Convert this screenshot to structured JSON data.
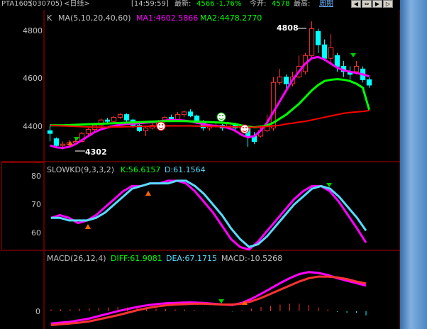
{
  "topbar": {
    "symbol": "PTA1605",
    "code": "(030705)",
    "period": "<日线>",
    "time": "[14:59:59]",
    "latest_label": "最新:",
    "latest_value": "4566",
    "change_pct": "-1.76%",
    "open_label": "今开:",
    "open_value": "4578",
    "high_label": "最高:",
    "cycle_label": "周期"
  },
  "kpanel": {
    "title": "K",
    "ma_label": "MA(5,10,20,40,60)",
    "ma1": "MA1:4602.5866",
    "ma2": "MA2:4478.2770",
    "ticks": [
      "4800",
      "4600",
      "4400"
    ],
    "high_mark": "4808",
    "low_mark": "4302"
  },
  "kdpanel": {
    "title": "SLOWKD(9,3,3,2)",
    "k": "K:56.6157",
    "d": "D:61.1564",
    "ticks": [
      "80",
      "70",
      "60"
    ]
  },
  "macdpanel": {
    "title": "MACD(26,12,4)",
    "diff": "DIFF:61.9081",
    "dea": "DEA:67.1715",
    "macd": "MACD:-10.5268",
    "ticks": [
      "0"
    ]
  },
  "colors": {
    "up": "#ff3232",
    "down": "#00ffff",
    "ma1": "#ff00ff",
    "ma2": "#00ff00",
    "ma3": "#ff0000",
    "kline": "#ff00ff",
    "dline": "#55ddff",
    "axis": "#c0c0c0",
    "panelborder": "#b00000"
  },
  "chart_data": [
    {
      "type": "candlestick",
      "title": "K",
      "ylim": [
        4290,
        4850
      ],
      "candles": [
        [
          4400,
          4390,
          4425,
          4360
        ],
        [
          4370,
          4345,
          4375,
          4335
        ],
        [
          4345,
          4350,
          4360,
          4330
        ],
        [
          4350,
          4355,
          4365,
          4340
        ],
        [
          4355,
          4360,
          4370,
          4345
        ],
        [
          4360,
          4390,
          4395,
          4355
        ],
        [
          4390,
          4405,
          4410,
          4385
        ],
        [
          4405,
          4420,
          4425,
          4395
        ],
        [
          4420,
          4440,
          4445,
          4410
        ],
        [
          4440,
          4435,
          4448,
          4430
        ],
        [
          4435,
          4450,
          4455,
          4428
        ],
        [
          4450,
          4460,
          4465,
          4445
        ],
        [
          4460,
          4440,
          4465,
          4430
        ],
        [
          4440,
          4420,
          4445,
          4410
        ],
        [
          4420,
          4400,
          4425,
          4395
        ],
        [
          4400,
          4410,
          4415,
          4380
        ],
        [
          4410,
          4420,
          4430,
          4405
        ],
        [
          4420,
          4435,
          4440,
          4415
        ],
        [
          4435,
          4450,
          4455,
          4430
        ],
        [
          4450,
          4440,
          4460,
          4435
        ],
        [
          4440,
          4460,
          4470,
          4435
        ],
        [
          4460,
          4470,
          4475,
          4450
        ],
        [
          4470,
          4455,
          4480,
          4450
        ],
        [
          4455,
          4430,
          4460,
          4425
        ],
        [
          4430,
          4410,
          4440,
          4400
        ],
        [
          4410,
          4420,
          4425,
          4400
        ],
        [
          4420,
          4420,
          4430,
          4410
        ],
        [
          4420,
          4410,
          4425,
          4400
        ],
        [
          4410,
          4425,
          4430,
          4405
        ],
        [
          4425,
          4410,
          4430,
          4400
        ],
        [
          4410,
          4415,
          4420,
          4405
        ],
        [
          4415,
          4380,
          4420,
          4340
        ],
        [
          4380,
          4360,
          4395,
          4350
        ],
        [
          4380,
          4400,
          4420,
          4375
        ],
        [
          4400,
          4420,
          4460,
          4395
        ],
        [
          4410,
          4580,
          4600,
          4400
        ],
        [
          4580,
          4600,
          4630,
          4570
        ],
        [
          4600,
          4575,
          4610,
          4560
        ],
        [
          4575,
          4600,
          4620,
          4565
        ],
        [
          4600,
          4640,
          4680,
          4595
        ],
        [
          4620,
          4680,
          4690,
          4610
        ],
        [
          4680,
          4780,
          4808,
          4670
        ],
        [
          4770,
          4720,
          4780,
          4690
        ],
        [
          4720,
          4670,
          4740,
          4660
        ],
        [
          4670,
          4710,
          4760,
          4650
        ],
        [
          4680,
          4640,
          4690,
          4620
        ],
        [
          4640,
          4620,
          4660,
          4600
        ],
        [
          4620,
          4610,
          4640,
          4590
        ],
        [
          4620,
          4640,
          4660,
          4610
        ],
        [
          4630,
          4590,
          4640,
          4580
        ],
        [
          4590,
          4570,
          4600,
          4560
        ]
      ],
      "series": [
        {
          "name": "MA1",
          "values": [
            4345,
            4338,
            4336,
            4340,
            4350,
            4365,
            4380,
            4395,
            4405,
            4412,
            4418,
            4422,
            4425,
            4426,
            4428,
            4430,
            4432,
            4435,
            4438,
            4440,
            4440,
            4438,
            4435,
            4430,
            4425,
            4420,
            4418,
            4415,
            4410,
            4400,
            4385,
            4375,
            4380,
            4400,
            4430,
            4470,
            4510,
            4550,
            4590,
            4620,
            4650,
            4670,
            4675,
            4665,
            4650,
            4635,
            4625,
            4620,
            4615,
            4610,
            4602.5866
          ]
        },
        {
          "name": "MA2",
          "values": [
            4420,
            4420,
            4420,
            4421,
            4422,
            4423,
            4424,
            4425,
            4426,
            4427,
            4428,
            4429,
            4430,
            4431,
            4432,
            4433,
            4434,
            4435,
            4436,
            4436,
            4436,
            4436,
            4435,
            4434,
            4433,
            4432,
            4431,
            4430,
            4428,
            4425,
            4420,
            4415,
            4413,
            4415,
            4420,
            4430,
            4445,
            4460,
            4480,
            4500,
            4525,
            4550,
            4570,
            4585,
            4590,
            4592,
            4590,
            4585,
            4575,
            4560,
            4478.277
          ]
        },
        {
          "name": "MA3",
          "values": [
            4420,
            4419,
            4418,
            4417,
            4416,
            4415,
            4414,
            4413,
            4413,
            4413,
            4414,
            4414,
            4415,
            4415,
            4416,
            4416,
            4417,
            4417,
            4418,
            4418,
            4418,
            4418,
            4418,
            4417,
            4417,
            4416,
            4416,
            4415,
            4415,
            4414,
            4413,
            4412,
            4413,
            4414,
            4416,
            4418,
            4420,
            4425,
            4428,
            4432,
            4435,
            4440,
            4445,
            4450,
            4455,
            4460,
            4465,
            4468,
            4470,
            4472,
            4475
          ]
        }
      ]
    },
    {
      "type": "line",
      "title": "SLOWKD(9,3,3,2)",
      "ylim": [
        54,
        84
      ],
      "series": [
        {
          "name": "K",
          "values": [
            66,
            67,
            66,
            64,
            65,
            67,
            70,
            73,
            76,
            78,
            78,
            79,
            79,
            80,
            80,
            79,
            76,
            72,
            68,
            63,
            58,
            55,
            54,
            57,
            61,
            65,
            69,
            73,
            76,
            78,
            78,
            76,
            72,
            67,
            62,
            56.6157
          ]
        },
        {
          "name": "D",
          "values": [
            66,
            66,
            65,
            65,
            65,
            66,
            68,
            71,
            74,
            77,
            78,
            79,
            79,
            79,
            80,
            80,
            78,
            75,
            71,
            67,
            62,
            58,
            55,
            56,
            59,
            63,
            67,
            71,
            74,
            77,
            78,
            77,
            74,
            70,
            66,
            61.1564
          ]
        }
      ]
    },
    {
      "type": "line",
      "title": "MACD(26,12,4)",
      "ylim": [
        -40,
        110
      ],
      "series": [
        {
          "name": "DIFF",
          "values": [
            -30,
            -28,
            -26,
            -22,
            -18,
            -12,
            -6,
            0,
            5,
            10,
            14,
            17,
            19,
            20,
            21,
            21,
            20,
            18,
            16,
            15,
            20,
            30,
            42,
            55,
            68,
            80,
            90,
            95,
            93,
            88,
            80,
            74,
            68,
            61.9081
          ]
        },
        {
          "name": "DEA",
          "values": [
            -34,
            -32,
            -30,
            -28,
            -25,
            -20,
            -15,
            -10,
            -4,
            2,
            7,
            11,
            14,
            16,
            17,
            18,
            18,
            17,
            16,
            16,
            18,
            24,
            32,
            42,
            52,
            62,
            72,
            80,
            84,
            84,
            82,
            78,
            72,
            67.1715
          ]
        },
        {
          "name": "MACD",
          "values": [
            4,
            4,
            4,
            6,
            7,
            8,
            9,
            10,
            9,
            8,
            7,
            6,
            5,
            4,
            4,
            3,
            2,
            1,
            0,
            -1,
            2,
            6,
            10,
            13,
            16,
            18,
            18,
            15,
            9,
            4,
            -2,
            -4,
            -4,
            -10.5268
          ]
        }
      ]
    }
  ]
}
